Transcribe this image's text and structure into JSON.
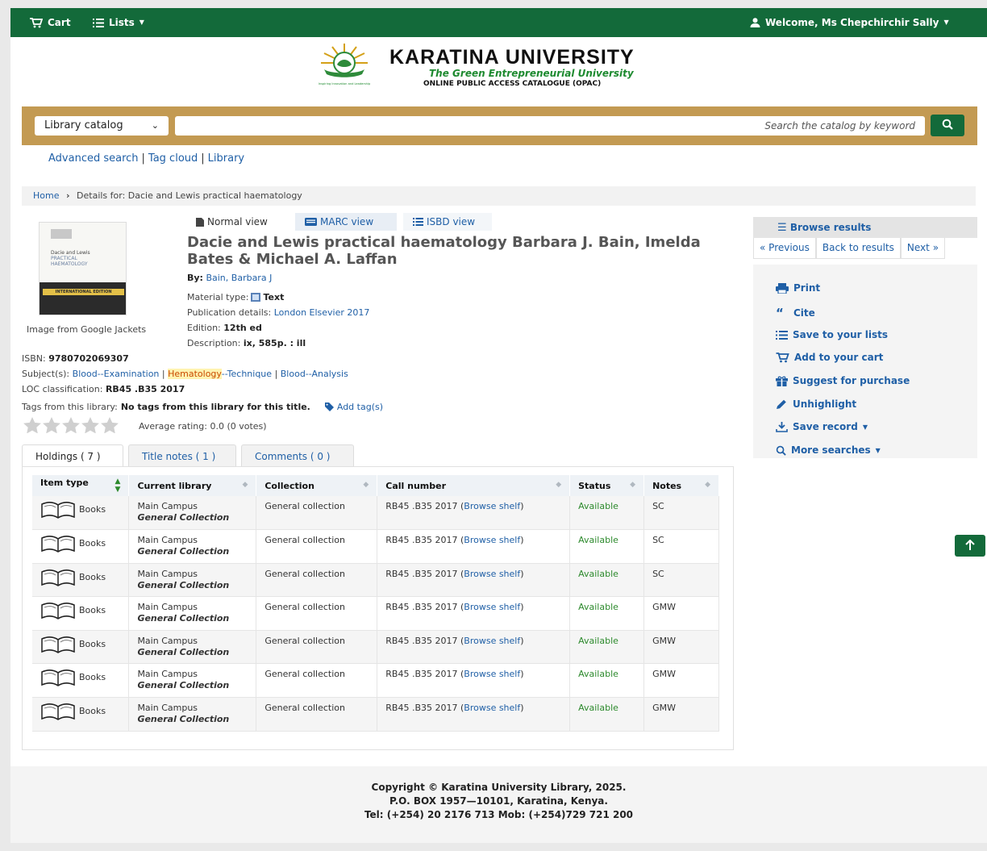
{
  "navbar": {
    "cart": "Cart",
    "lists": "Lists",
    "welcome": "Welcome, Ms Chepchirchir Sally"
  },
  "header": {
    "name": "KARATINA UNIVERSITY",
    "tagline": "The Green Entrepreneurial University",
    "subtitle": "ONLINE PUBLIC ACCESS CATALOGUE (OPAC)",
    "logo_motto": "Inspiring Innovation and Leadership"
  },
  "search": {
    "catalog_label": "Library catalog",
    "placeholder": "Search the catalog by keyword"
  },
  "sublinks": [
    "Advanced search",
    "Tag cloud",
    "Library"
  ],
  "breadcrumb": {
    "home": "Home",
    "current": "Details for: Dacie and Lewis practical haematology"
  },
  "cover": {
    "caption": "Image from Google Jackets",
    "text_1": "Dacie and Lewis",
    "text_2": "PRACTICAL",
    "text_3": "HAEMATOLOGY",
    "band": "INTERNATIONAL EDITION"
  },
  "view_tabs": [
    "Normal view",
    "MARC view",
    "ISBD view"
  ],
  "record": {
    "title": "Dacie and Lewis practical haematology Barbara J. Bain, Imelda Bates & Michael A. Laffan",
    "by_label": "By:",
    "author": "Bain, Barbara J",
    "material_label": "Material type:",
    "material_value": "Text",
    "publication_label": "Publication details:",
    "publication_value": "London Elsevier 2017",
    "edition_label": "Edition:",
    "edition_value": "12th ed",
    "description_label": "Description:",
    "description_value": "ix, 585p. : ill",
    "isbn_label": "ISBN:",
    "isbn_value": "9780702069307",
    "subjects_label": "Subject(s):",
    "subject_1": "Blood--Examination",
    "subject_2_highlight": "Hematology",
    "subject_2_rest": "--Technique",
    "subject_3": "Blood--Analysis",
    "loc_label": "LOC classification:",
    "loc_value": "RB45 .B35 2017",
    "tags_label": "Tags from this library:",
    "tags_value": "No tags from this library for this title.",
    "add_tag": "Add tag(s)",
    "rating": "Average rating: 0.0 (0 votes)"
  },
  "browse": {
    "header": "Browse results",
    "previous": "Previous",
    "back": "Back to results",
    "next": "Next"
  },
  "actions": [
    "Print",
    "Cite",
    "Save to your lists",
    "Add to your cart",
    "Suggest for purchase",
    "Unhighlight",
    "Save record",
    "More searches"
  ],
  "holdings_tabs": [
    "Holdings ( 7 )",
    "Title notes ( 1 )",
    "Comments ( 0 )"
  ],
  "holdings": {
    "columns": [
      "Item type",
      "Current library",
      "Collection",
      "Call number",
      "Status",
      "Notes"
    ],
    "browse_link": "Browse shelf",
    "rows": [
      {
        "type": "Books",
        "library": "Main Campus",
        "sublibrary": "General Collection",
        "collection": "General collection",
        "call": "RB45 .B35 2017",
        "status": "Available",
        "notes": "SC"
      },
      {
        "type": "Books",
        "library": "Main Campus",
        "sublibrary": "General Collection",
        "collection": "General collection",
        "call": "RB45 .B35 2017",
        "status": "Available",
        "notes": "SC"
      },
      {
        "type": "Books",
        "library": "Main Campus",
        "sublibrary": "General Collection",
        "collection": "General collection",
        "call": "RB45 .B35 2017",
        "status": "Available",
        "notes": "SC"
      },
      {
        "type": "Books",
        "library": "Main Campus",
        "sublibrary": "General Collection",
        "collection": "General collection",
        "call": "RB45 .B35 2017",
        "status": "Available",
        "notes": "GMW"
      },
      {
        "type": "Books",
        "library": "Main Campus",
        "sublibrary": "General Collection",
        "collection": "General collection",
        "call": "RB45 .B35 2017",
        "status": "Available",
        "notes": "GMW"
      },
      {
        "type": "Books",
        "library": "Main Campus",
        "sublibrary": "General Collection",
        "collection": "General collection",
        "call": "RB45 .B35 2017",
        "status": "Available",
        "notes": "GMW"
      },
      {
        "type": "Books",
        "library": "Main Campus",
        "sublibrary": "General Collection",
        "collection": "General collection",
        "call": "RB45 .B35 2017",
        "status": "Available",
        "notes": "GMW"
      }
    ]
  },
  "footer": {
    "line1": "Copyright © Karatina University Library, 2025.",
    "line2": "P.O. BOX 1957—10101, Karatina, Kenya.",
    "line3": "Tel: (+254) 20 2176 713 Mob: (+254)729 721 200"
  },
  "colors": {
    "brand_green": "#136a3a",
    "search_bar": "#c39a52",
    "link_blue": "#1f5fa6",
    "available_green": "#2d8a2d"
  }
}
